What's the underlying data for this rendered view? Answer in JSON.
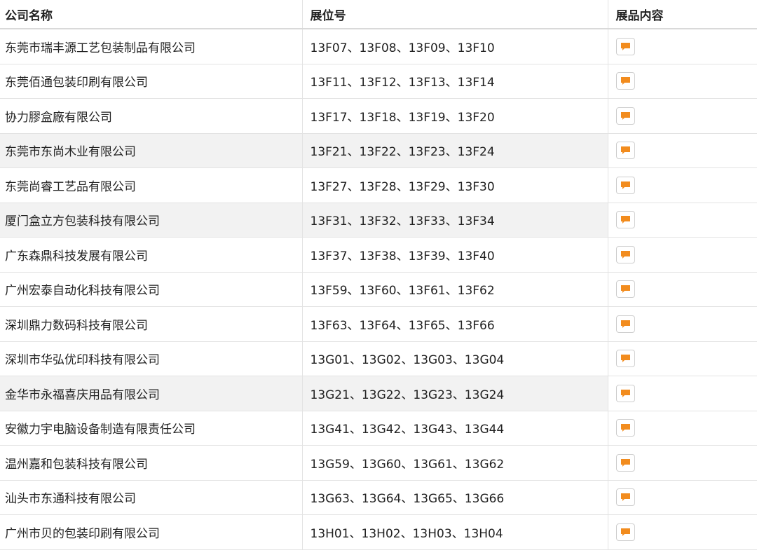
{
  "header": {
    "company": "公司名称",
    "booth": "展位号",
    "products": "展品内容"
  },
  "colors": {
    "accent": "#f28c1e",
    "alt_row": "#f2f2f2",
    "border": "#e3e3e3"
  },
  "icons": {
    "products": "chat-bubble-icon"
  },
  "rows": [
    {
      "company": "东莞市瑞丰源工艺包装制品有限公司",
      "booth": "13F07、13F08、13F09、13F10",
      "alt": false
    },
    {
      "company": "东莞佰通包装印刷有限公司",
      "booth": "13F11、13F12、13F13、13F14",
      "alt": false
    },
    {
      "company": "协力膠盒廠有限公司",
      "booth": "13F17、13F18、13F19、13F20",
      "alt": false
    },
    {
      "company": "东莞市东尚木业有限公司",
      "booth": "13F21、13F22、13F23、13F24",
      "alt": true
    },
    {
      "company": "东莞尚睿工艺品有限公司",
      "booth": "13F27、13F28、13F29、13F30",
      "alt": false
    },
    {
      "company": "厦门盒立方包装科技有限公司",
      "booth": "13F31、13F32、13F33、13F34",
      "alt": true
    },
    {
      "company": "广东森鼎科技发展有限公司",
      "booth": "13F37、13F38、13F39、13F40",
      "alt": false
    },
    {
      "company": "广州宏泰自动化科技有限公司",
      "booth": "13F59、13F60、13F61、13F62",
      "alt": false
    },
    {
      "company": "深圳鼎力数码科技有限公司",
      "booth": "13F63、13F64、13F65、13F66",
      "alt": false
    },
    {
      "company": "深圳市华弘优印科技有限公司",
      "booth": "13G01、13G02、13G03、13G04",
      "alt": false
    },
    {
      "company": "金华市永福喜庆用品有限公司",
      "booth": "13G21、13G22、13G23、13G24",
      "alt": true
    },
    {
      "company": "安徽力宇电脑设备制造有限责任公司",
      "booth": "13G41、13G42、13G43、13G44",
      "alt": false
    },
    {
      "company": "温州嘉和包装科技有限公司",
      "booth": "13G59、13G60、13G61、13G62",
      "alt": false
    },
    {
      "company": "汕头市东通科技有限公司",
      "booth": "13G63、13G64、13G65、13G66",
      "alt": false
    },
    {
      "company": "广州市贝的包装印刷有限公司",
      "booth": "13H01、13H02、13H03、13H04",
      "alt": false
    }
  ]
}
